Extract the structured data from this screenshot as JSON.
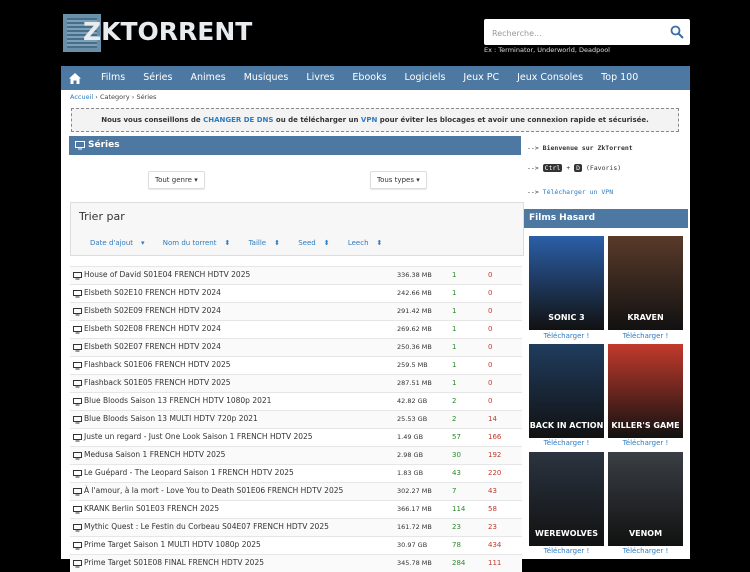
{
  "site": {
    "logo_text": "ZKTORRENT"
  },
  "search": {
    "placeholder": "Recherche...",
    "example": "Ex : Terminator, Underworld, Deadpool"
  },
  "nav": {
    "items": [
      "Films",
      "Séries",
      "Animes",
      "Musiques",
      "Livres",
      "Ebooks",
      "Logiciels",
      "Jeux PC",
      "Jeux Consoles",
      "Top 100"
    ]
  },
  "breadcrumb": {
    "home": "Accueil",
    "category": "Category",
    "current": "Séries",
    "sep": "›"
  },
  "notice": {
    "pre": "Nous vous conseillons de",
    "dns": "CHANGER DE DNS",
    "mid": "ou de télécharger un",
    "vpn": "VPN",
    "post": "pour éviter les blocages et avoir une connexion rapide et sécurisée."
  },
  "section": {
    "title": "Séries"
  },
  "filters": {
    "genre": "Tout genre",
    "types": "Tous types"
  },
  "sort": {
    "title": "Trier par",
    "links": [
      "Date d'ajout",
      "Nom du torrent",
      "Taille",
      "Seed",
      "Leech"
    ]
  },
  "torrents": [
    {
      "name": "House of David S01E04 FRENCH HDTV 2025",
      "size": "336.38 MB",
      "seed": "1",
      "leech": "0"
    },
    {
      "name": "Elsbeth S02E10 FRENCH HDTV 2024",
      "size": "242.66 MB",
      "seed": "1",
      "leech": "0"
    },
    {
      "name": "Elsbeth S02E09 FRENCH HDTV 2024",
      "size": "291.42 MB",
      "seed": "1",
      "leech": "0"
    },
    {
      "name": "Elsbeth S02E08 FRENCH HDTV 2024",
      "size": "269.62 MB",
      "seed": "1",
      "leech": "0"
    },
    {
      "name": "Elsbeth S02E07 FRENCH HDTV 2024",
      "size": "250.36 MB",
      "seed": "1",
      "leech": "0"
    },
    {
      "name": "Flashback S01E06 FRENCH HDTV 2025",
      "size": "259.5 MB",
      "seed": "1",
      "leech": "0"
    },
    {
      "name": "Flashback S01E05 FRENCH HDTV 2025",
      "size": "287.51 MB",
      "seed": "1",
      "leech": "0"
    },
    {
      "name": "Blue Bloods Saison 13 FRENCH HDTV 1080p 2021",
      "size": "42.82 GB",
      "seed": "2",
      "leech": "0"
    },
    {
      "name": "Blue Bloods Saison 13 MULTI HDTV 720p 2021",
      "size": "25.53 GB",
      "seed": "2",
      "leech": "14"
    },
    {
      "name": "Juste un regard - Just One Look Saison 1 FRENCH HDTV 2025",
      "size": "1.49 GB",
      "seed": "57",
      "leech": "166"
    },
    {
      "name": "Medusa Saison 1 FRENCH HDTV 2025",
      "size": "2.98 GB",
      "seed": "30",
      "leech": "192"
    },
    {
      "name": "Le Guépard - The Leopard Saison 1 FRENCH HDTV 2025",
      "size": "1.83 GB",
      "seed": "43",
      "leech": "220"
    },
    {
      "name": "À l'amour, à la mort - Love You to Death S01E06 FRENCH HDTV 2025",
      "size": "302.27 MB",
      "seed": "7",
      "leech": "43"
    },
    {
      "name": "KRANK Berlin S01E03 FRENCH 2025",
      "size": "366.17 MB",
      "seed": "114",
      "leech": "58"
    },
    {
      "name": "Mythic Quest : Le Festin du Corbeau S04E07 FRENCH HDTV 2025",
      "size": "161.72 MB",
      "seed": "23",
      "leech": "23"
    },
    {
      "name": "Prime Target Saison 1 MULTI HDTV 1080p 2025",
      "size": "30.97 GB",
      "seed": "78",
      "leech": "434"
    },
    {
      "name": "Prime Target S01E08 FINAL FRENCH HDTV 2025",
      "size": "345.78 MB",
      "seed": "284",
      "leech": "111"
    }
  ],
  "sidebar": {
    "arrow": "-->",
    "welcome": "Bienvenue sur ZkTorrent",
    "key1": "Ctrl",
    "plus": "+",
    "key2": "D",
    "favoris": "(Favoris)",
    "vpn_link": "Télécharger un VPN",
    "films_title": "Films Hasard",
    "download_label": "Télécharger !",
    "posters": [
      {
        "title": "SONIC 3",
        "color": "#2b5fa8"
      },
      {
        "title": "KRAVEN",
        "color": "#5a3a2a"
      },
      {
        "title": "BACK IN ACTION",
        "color": "#1f3c5e"
      },
      {
        "title": "KILLER'S GAME",
        "color": "#c23a2c"
      },
      {
        "title": "WEREWOLVES",
        "color": "#2b3440"
      },
      {
        "title": "VENOM",
        "color": "#3a3f45"
      }
    ]
  }
}
